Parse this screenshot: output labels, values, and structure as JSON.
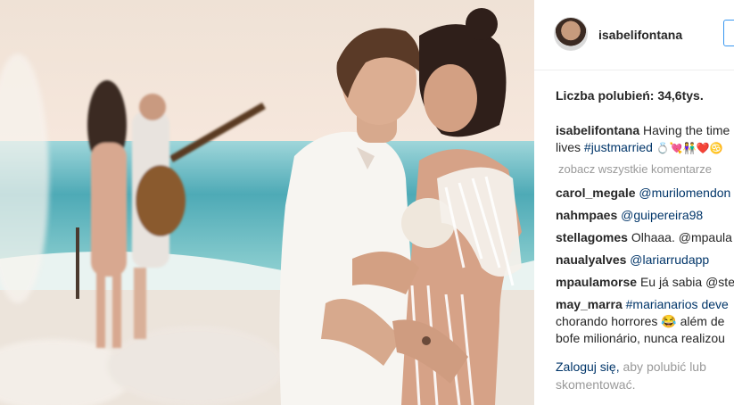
{
  "post": {
    "username": "isabelifontana",
    "likes_text": "Liczba polubień: 34,6tys.",
    "caption": {
      "user": "isabelifontana",
      "line1": "Having the time",
      "line2_text": "lives",
      "line2_tag": "#justmarried",
      "emojis": "💍💘👫❤️♋"
    },
    "view_all_comments": "zobacz wszystkie komentarze",
    "comments": [
      {
        "user": "carol_megale",
        "text": "@murilomendon"
      },
      {
        "user": "nahmpaes",
        "text": "@guipereira98"
      },
      {
        "user": "stellagomes",
        "text": "Olhaaa. @mpaula"
      },
      {
        "user": "naualyalves",
        "text": "@lariarrudapp"
      },
      {
        "user": "mpaulamorse",
        "text": "Eu já sabia @ste"
      },
      {
        "user": "may_marra",
        "text": "#marianarios deve",
        "line2": "chorando horrores 😂 além de",
        "line3": "bofe milionário, nunca realizou"
      }
    ],
    "login": {
      "link": "Zaloguj się,",
      "rest": "aby polubić lub skomentować."
    }
  },
  "colors": {
    "link": "#003569",
    "follow_border": "#3897f0",
    "muted": "#999999"
  }
}
